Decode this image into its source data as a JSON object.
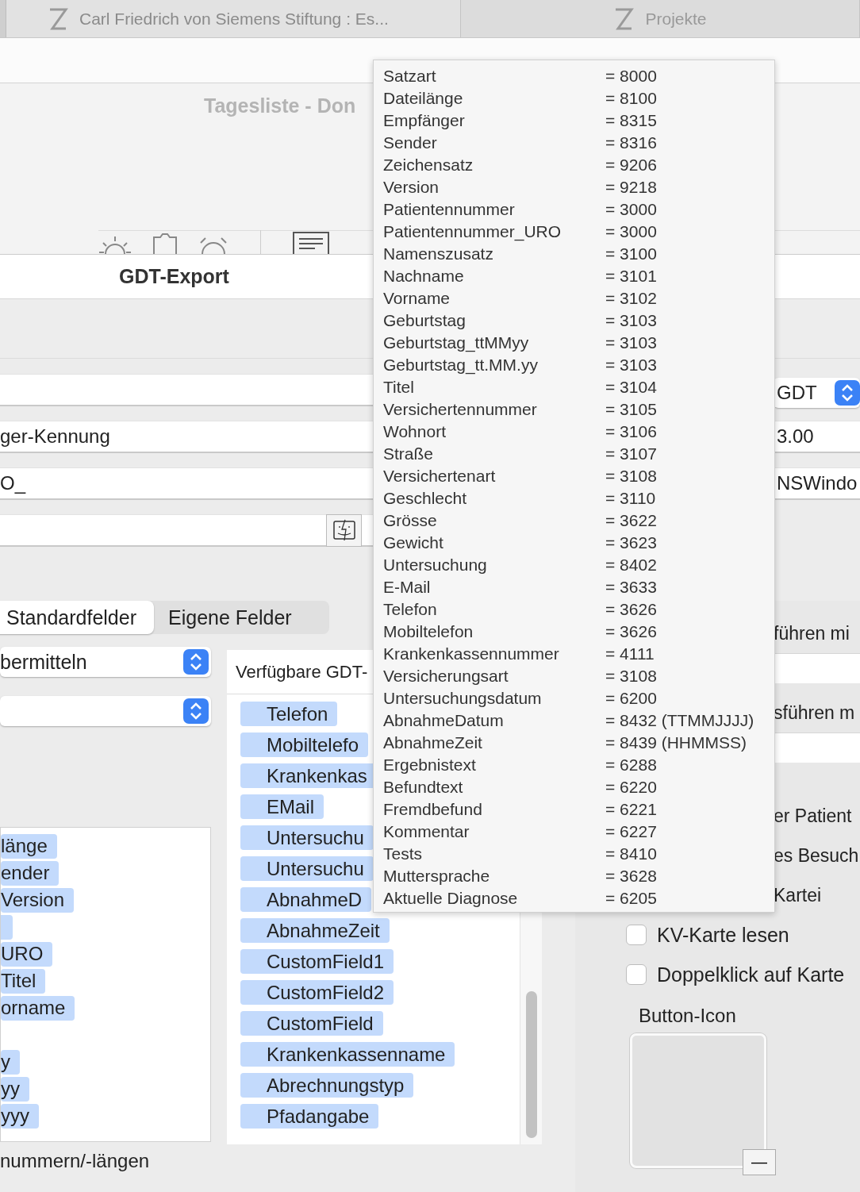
{
  "window_tabs": [
    {
      "label": "Carl Friedrich von Siemens Stiftung : Es...",
      "selected": true
    },
    {
      "label": "Projekte",
      "selected": false
    }
  ],
  "day_list": {
    "title": "Tagesliste - Don"
  },
  "sheet": {
    "title": "GDT-Export",
    "fields": [
      {
        "right": {
          "kind": "popup",
          "value": "GDT"
        }
      },
      {
        "value": "ger-Kennung",
        "right": {
          "kind": "field",
          "value": "3.00"
        }
      },
      {
        "value": "O_",
        "right": {
          "kind": "field",
          "value": "NSWindo"
        }
      },
      {
        "right": {
          "kind": "none"
        }
      }
    ],
    "segments": [
      {
        "label": "Standardfelder",
        "selected": true
      },
      {
        "label": "Eigene Felder",
        "selected": false
      }
    ],
    "popups": [
      {
        "kind": "popup",
        "value": "bermitteln"
      },
      {
        "kind": "popup"
      }
    ],
    "selected_fields": [
      {
        "kind": "chip",
        "label": "länge"
      },
      {
        "kind": "chip",
        "label": "ender"
      },
      {
        "kind": "chip",
        "label": "Version"
      },
      {
        "kind": "blank"
      },
      {
        "kind": "chip",
        "label": "URO"
      },
      {
        "kind": "chip",
        "label": "Titel"
      },
      {
        "kind": "chip",
        "label": "orname"
      },
      {
        "kind": "gap"
      },
      {
        "kind": "chip",
        "label": "y"
      },
      {
        "kind": "chip",
        "label": "yy"
      },
      {
        "kind": "chip",
        "label": "yyy"
      }
    ],
    "footer_label": "nummern/-längen",
    "available": {
      "title": "Verfügbare GDT-",
      "items": [
        "Telefon",
        "Mobiltelefo",
        "Krankenkas",
        "EMail",
        "Untersuchu",
        "Untersuchu",
        "AbnahmeD",
        "AbnahmeZeit",
        "CustomField1",
        "CustomField2",
        "CustomField",
        "Krankenkassenname",
        "Abrechnungstyp",
        "Pfadangabe"
      ]
    },
    "options": [
      {
        "kind": "label",
        "label": "führen mi"
      },
      {
        "kind": "field"
      },
      {
        "kind": "label",
        "label": "sführen m"
      },
      {
        "kind": "field"
      },
      {
        "kind": "label",
        "label": "er Patient"
      },
      {
        "kind": "label",
        "label": "es Besuch"
      },
      {
        "kind": "label",
        "label": "Kartei"
      },
      {
        "kind": "checkbox",
        "label": "KV-Karte lesen",
        "checked": false
      },
      {
        "kind": "checkbox",
        "label": "Doppelklick auf Karte",
        "checked": false
      }
    ],
    "button_icon": {
      "label": "Button-Icon",
      "remove": "—"
    }
  },
  "tooltip": [
    {
      "name": "Satzart",
      "value": "= 8000"
    },
    {
      "name": "Dateilänge",
      "value": "= 8100"
    },
    {
      "name": "Empfänger",
      "value": "= 8315"
    },
    {
      "name": "Sender",
      "value": "= 8316"
    },
    {
      "name": "Zeichensatz",
      "value": "= 9206"
    },
    {
      "name": "Version",
      "value": "= 9218"
    },
    {
      "name": "Patientennummer",
      "value": "= 3000"
    },
    {
      "name": "Patientennummer_URO",
      "value": "= 3000"
    },
    {
      "name": "Namenszusatz",
      "value": "= 3100"
    },
    {
      "name": "Nachname",
      "value": "= 3101"
    },
    {
      "name": "Vorname",
      "value": "= 3102"
    },
    {
      "name": "Geburtstag",
      "value": "= 3103"
    },
    {
      "name": "Geburtstag_ttMMyy",
      "value": "= 3103"
    },
    {
      "name": "Geburtstag_tt.MM.yy",
      "value": "= 3103"
    },
    {
      "name": "Titel",
      "value": "= 3104"
    },
    {
      "name": "Versichertennummer",
      "value": "= 3105"
    },
    {
      "name": "Wohnort",
      "value": "= 3106"
    },
    {
      "name": "Straße",
      "value": "= 3107"
    },
    {
      "name": "Versichertenart",
      "value": "= 3108"
    },
    {
      "name": "Geschlecht",
      "value": "= 3110"
    },
    {
      "name": "Grösse",
      "value": "= 3622"
    },
    {
      "name": "Gewicht",
      "value": "= 3623"
    },
    {
      "name": "Untersuchung",
      "value": "= 8402"
    },
    {
      "name": "E-Mail",
      "value": "= 3633"
    },
    {
      "name": "Telefon",
      "value": "= 3626"
    },
    {
      "name": "Mobiltelefon",
      "value": "= 3626"
    },
    {
      "name": "Krankenkassennummer",
      "value": "= 4111"
    },
    {
      "name": "Versicherungsart",
      "value": "= 3108"
    },
    {
      "name": "Untersuchungsdatum",
      "value": "= 6200"
    },
    {
      "name": "AbnahmeDatum",
      "value": "= 8432 (TTMMJJJJ)"
    },
    {
      "name": "AbnahmeZeit",
      "value": "= 8439 (HHMMSS)"
    },
    {
      "name": "Ergebnistext",
      "value": "= 6288"
    },
    {
      "name": "Befundtext",
      "value": "= 6220"
    },
    {
      "name": "Fremdbefund",
      "value": "= 6221"
    },
    {
      "name": "Kommentar",
      "value": "= 6227"
    },
    {
      "name": "Tests",
      "value": "= 8410"
    },
    {
      "name": "Muttersprache",
      "value": "= 3628"
    },
    {
      "name": "Aktuelle Diagnose",
      "value": "= 6205"
    }
  ]
}
